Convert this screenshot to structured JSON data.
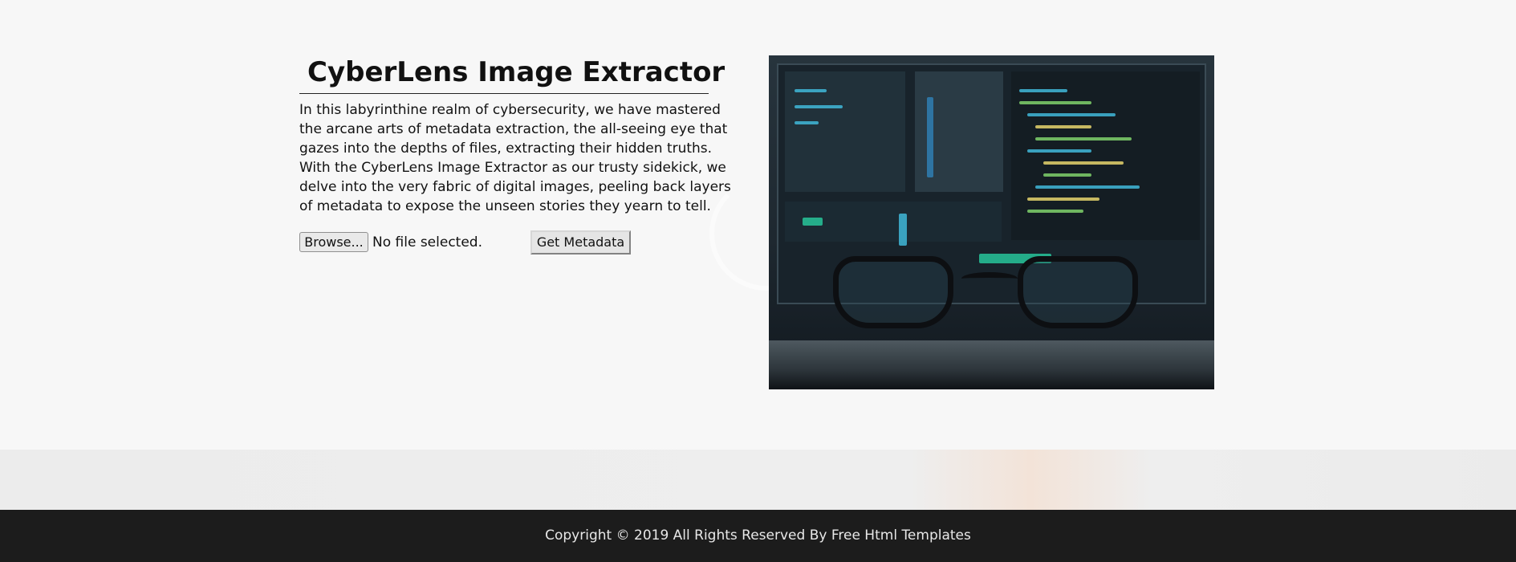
{
  "main": {
    "title": "CyberLens Image Extractor",
    "description": "In this labyrinthine realm of cybersecurity, we have mastered the arcane arts of metadata extraction, the all-seeing eye that gazes into the depths of files, extracting their hidden truths. With the CyberLens Image Extractor as our trusty sidekick, we delve into the very fabric of digital images, peeling back layers of metadata to expose the unseen stories they yearn to tell.",
    "file_input": {
      "button_label": "Browse...",
      "status": "No file selected."
    },
    "submit_label": "Get Metadata"
  },
  "hero_image": {
    "icon": "code-screen-with-glasses-photo"
  },
  "footer": {
    "copyright": "Copyright © 2019 All Rights Reserved By Free Html Templates"
  },
  "colors": {
    "page_background": "#f7f7f7",
    "footer_background": "#1c1c1c",
    "footer_text": "#e8e8e8"
  }
}
